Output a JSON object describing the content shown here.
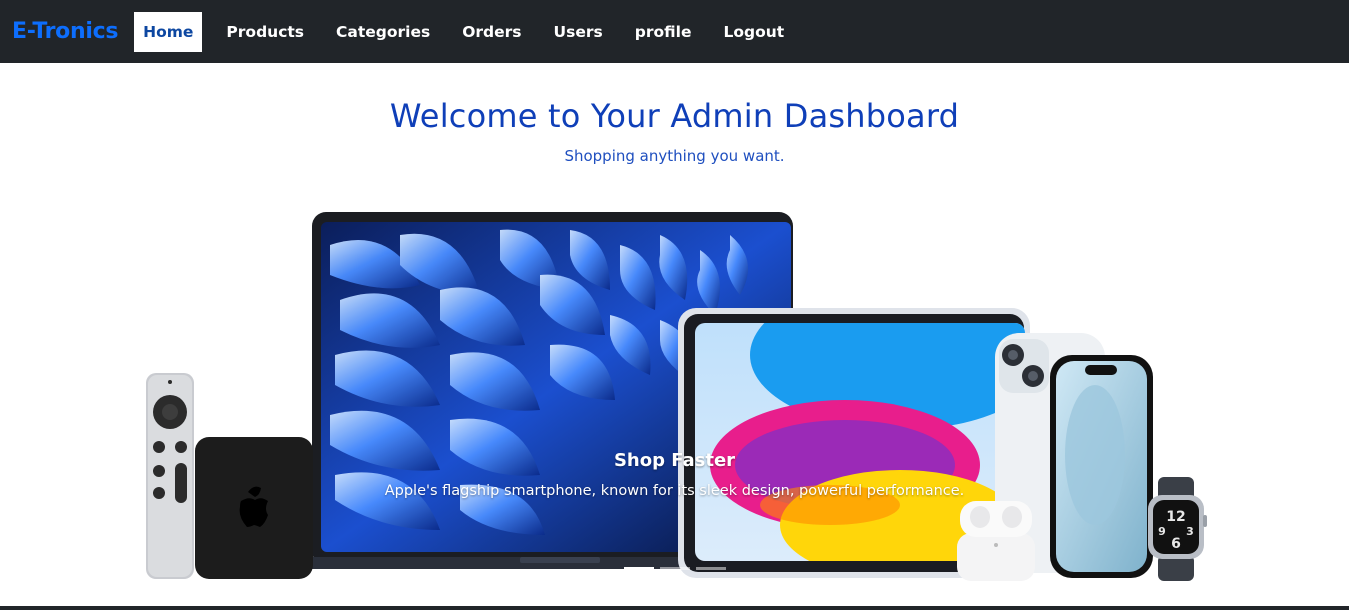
{
  "navbar": {
    "brand": "E-Tronics",
    "links": [
      {
        "label": "Home",
        "active": true
      },
      {
        "label": "Products"
      },
      {
        "label": "Categories"
      },
      {
        "label": "Orders"
      },
      {
        "label": "Users"
      },
      {
        "label": "profile"
      },
      {
        "label": "Logout"
      }
    ]
  },
  "hero": {
    "title": "Welcome to Your Admin Dashboard",
    "subtitle": "Shopping anything you want."
  },
  "carousel": {
    "caption_title": "Shop Faster",
    "caption_text": "Apple's flagship smartphone, known for its sleek design, powerful performance.",
    "slide_count": 3,
    "active_index": 0
  },
  "colors": {
    "navbar_bg": "#212529",
    "brand": "#0d6efd",
    "title": "#0f3fb8"
  }
}
